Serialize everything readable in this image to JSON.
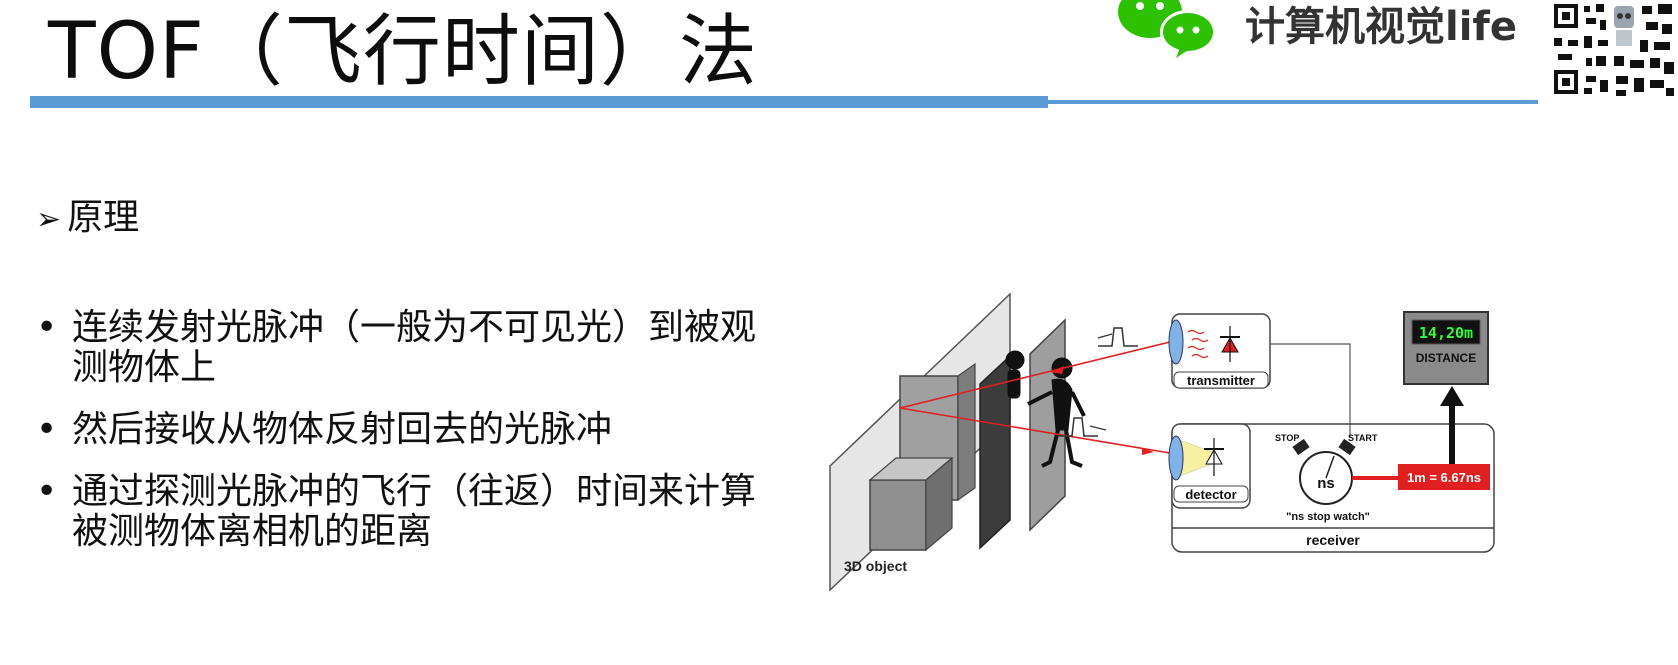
{
  "title": "TOF（飞行时间）法",
  "brand": {
    "name": "计算机视觉life",
    "wechat_icon": "wechat-icon",
    "qr_icon": "qr-code-icon"
  },
  "section": {
    "marker": "➢",
    "heading": "原理"
  },
  "bullets": [
    "连续发射光脉冲（一般为不可见光）到被观测物体上",
    "然后接收从物体反射回去的光脉冲",
    "通过探测光脉冲的飞行（往返）时间来计算被测物体离相机的距离"
  ],
  "diagram": {
    "object_label": "3D object",
    "transmitter_label": "transmitter",
    "detector_label": "detector",
    "receiver_label": "receiver",
    "stop_label": "STOP",
    "start_label": "START",
    "watch_face": "ns",
    "watch_caption": "\"ns stop watch\"",
    "conversion_label": "1m = 6.67ns",
    "display_value": "14,20m",
    "display_label": "DISTANCE"
  },
  "colors": {
    "accent_blue": "#5b9bd5",
    "laser_red": "#e02020",
    "display_green": "#2aff3a",
    "wechat_green": "#2dc100"
  }
}
